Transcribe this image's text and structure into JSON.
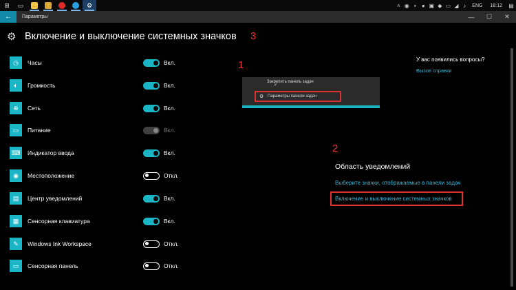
{
  "taskbar": {
    "apps": [
      {
        "name": "explorer-icon",
        "color": "#f0c24a"
      },
      {
        "name": "folder-icon",
        "color": "#e0b040"
      },
      {
        "name": "opera-icon",
        "color": "#e02a2a"
      },
      {
        "name": "skype-icon",
        "color": "#2aa0e0"
      },
      {
        "name": "settings-icon",
        "color": "#ffffff"
      }
    ],
    "tray": {
      "lang": "ENG",
      "time": "18:12"
    }
  },
  "window": {
    "title": "Параметры"
  },
  "page": {
    "title": "Включение и выключение системных значков"
  },
  "markers": {
    "m1": "1",
    "m2": "2",
    "m3": "3"
  },
  "items": [
    {
      "label": "Часы",
      "state": "Вкл.",
      "toggle": "on",
      "icon": "clock-icon"
    },
    {
      "label": "Громкость",
      "state": "Вкл.",
      "toggle": "on",
      "icon": "volume-icon"
    },
    {
      "label": "Сеть",
      "state": "Вкл.",
      "toggle": "on",
      "icon": "network-icon"
    },
    {
      "label": "Питание",
      "state": "Вкл.",
      "toggle": "disabled",
      "icon": "battery-icon"
    },
    {
      "label": "Индикатор ввода",
      "state": "Вкл.",
      "toggle": "on",
      "icon": "keyboard-icon"
    },
    {
      "label": "Местоположение",
      "state": "Откл.",
      "toggle": "off",
      "icon": "location-icon"
    },
    {
      "label": "Центр уведомлений",
      "state": "Вкл.",
      "toggle": "on",
      "icon": "notification-icon"
    },
    {
      "label": "Сенсорная клавиатура",
      "state": "Вкл.",
      "toggle": "on",
      "icon": "touch-keyboard-icon"
    },
    {
      "label": "Windows Ink Workspace",
      "state": "Откл.",
      "toggle": "off",
      "icon": "pen-icon"
    },
    {
      "label": "Сенсорная панель",
      "state": "Откл.",
      "toggle": "off",
      "icon": "touchpad-icon"
    }
  ],
  "context_menu": {
    "item1": "Закрепить панель задач",
    "item2": "Параметры панели задач"
  },
  "help": {
    "question": "У вас появились вопросы?",
    "link": "Вызов справки"
  },
  "notifications": {
    "title": "Область уведомлений",
    "link1": "Выберите значки, отображаемые в панели задач",
    "link2": "Включение и выключение системных значков"
  },
  "colors": {
    "accent": "#1ab6c6",
    "highlight": "#e03030",
    "link": "#3ab7d8"
  }
}
